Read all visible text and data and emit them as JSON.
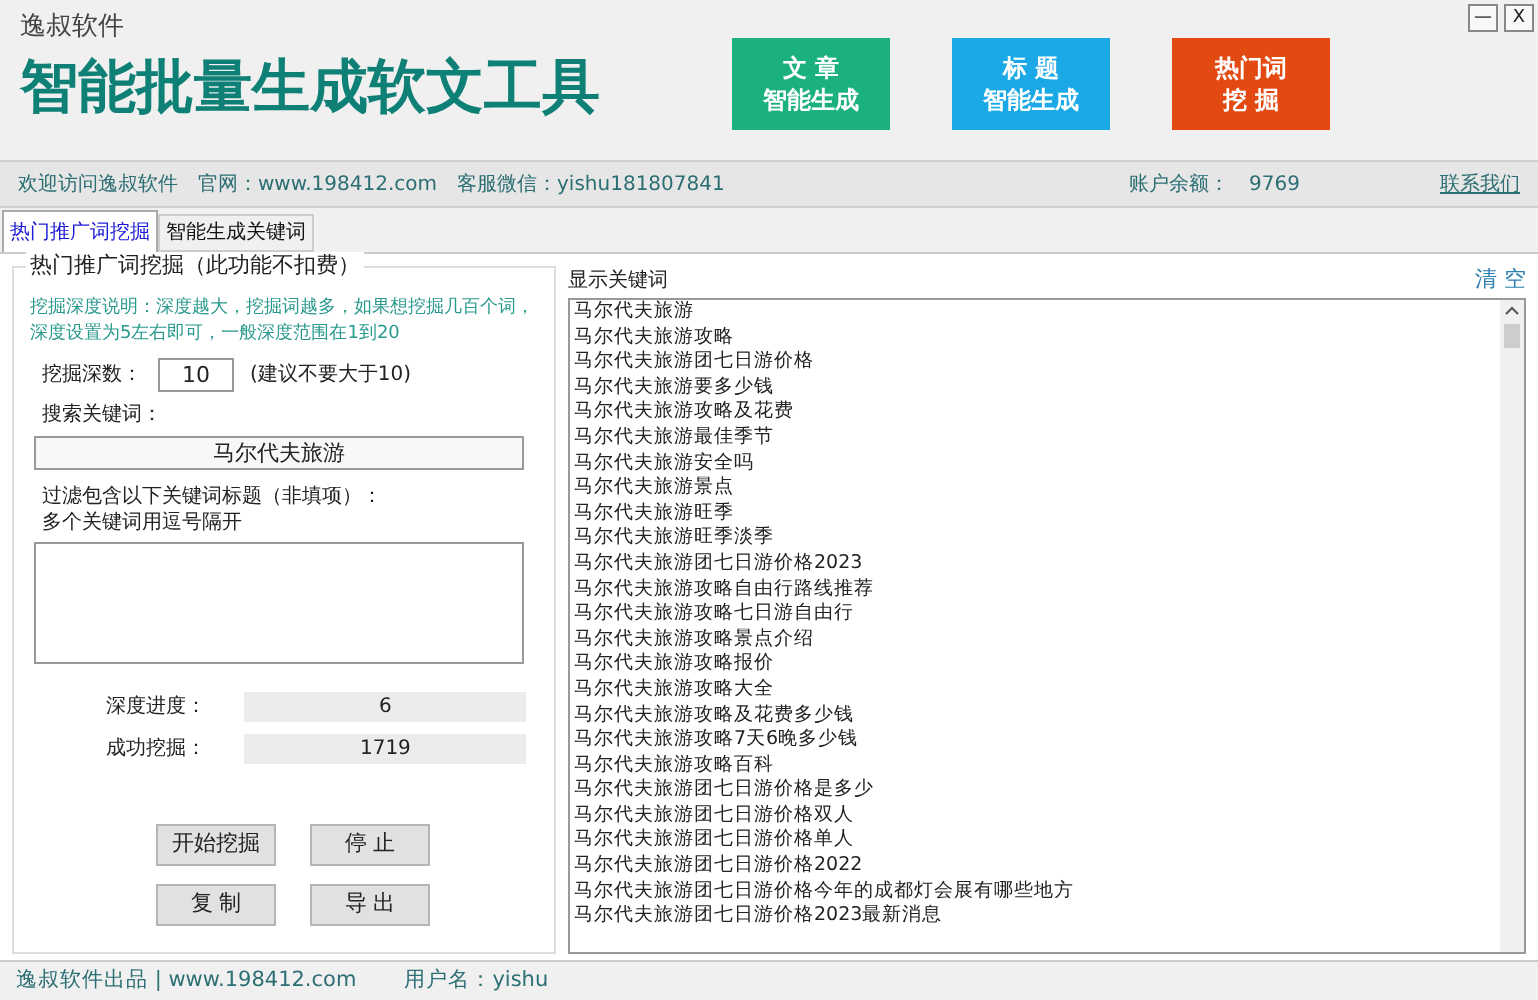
{
  "header": {
    "brand": "逸叔软件",
    "title": "智能批量生成软文工具"
  },
  "feature_buttons": [
    {
      "lines": [
        "文 章",
        "智能生成"
      ],
      "color": "#1bb07f"
    },
    {
      "lines": [
        "标 题",
        "智能生成"
      ],
      "color": "#1aa9e6"
    },
    {
      "lines": [
        "热门词",
        "挖 掘"
      ],
      "color": "#e24a12"
    }
  ],
  "window_controls": [
    "—",
    "X"
  ],
  "info_bar": {
    "welcome": "欢迎访问逸叔软件",
    "site": "官网：www.198412.com",
    "service": "客服微信：yishu181807841",
    "balance_label": "账户余额：",
    "balance": "9769",
    "contact": "联系我们"
  },
  "tabs": [
    {
      "label": "热门推广词挖掘",
      "selected": true
    },
    {
      "label": "智能生成关键词",
      "selected": false
    }
  ],
  "mining_panel": {
    "title": "热门推广词挖掘（此功能不扣费）",
    "note": "挖掘深度说明：深度越大，挖掘词越多，如果想挖掘几百个词，深度设置为5左右即可，一般深度范围在1到20",
    "depth_label": "挖掘深数：",
    "depth_value": "10",
    "depth_hint": "(建议不要大于10)",
    "search_label": "搜索关键词：",
    "search_value": "马尔代夫旅游",
    "filter_label": "过滤包含以下关键词标题（非填项）：",
    "filter_hint": "多个关键词用逗号隔开",
    "stats": [
      {
        "label": "深度进度：",
        "value": "6"
      },
      {
        "label": "成功挖掘：",
        "value": "1719"
      }
    ],
    "buttons": [
      "开始挖掘",
      "停 止",
      "复 制",
      "导 出"
    ]
  },
  "keywords_panel": {
    "title": "显示关键词",
    "clear": "清 空",
    "items": [
      "马尔代夫旅游",
      "马尔代夫旅游攻略",
      "马尔代夫旅游团七日游价格",
      "马尔代夫旅游要多少钱",
      "马尔代夫旅游攻略及花费",
      "马尔代夫旅游最佳季节",
      "马尔代夫旅游安全吗",
      "马尔代夫旅游景点",
      "马尔代夫旅游旺季",
      "马尔代夫旅游旺季淡季",
      "马尔代夫旅游团七日游价格2023",
      "马尔代夫旅游攻略自由行路线推荐",
      "马尔代夫旅游攻略七日游自由行",
      "马尔代夫旅游攻略景点介绍",
      "马尔代夫旅游攻略报价",
      "马尔代夫旅游攻略大全",
      "马尔代夫旅游攻略及花费多少钱",
      "马尔代夫旅游攻略7天6晚多少钱",
      "马尔代夫旅游攻略百科",
      "马尔代夫旅游团七日游价格是多少",
      "马尔代夫旅游团七日游价格双人",
      "马尔代夫旅游团七日游价格单人",
      "马尔代夫旅游团七日游价格2022",
      "马尔代夫旅游团七日游价格今年的成都灯会展有哪些地方",
      "马尔代夫旅游团七日游价格2023最新消息"
    ]
  },
  "status_bar": {
    "credit": "逸叔软件出品 | www.198412.com",
    "user": "用户名：yishu"
  }
}
